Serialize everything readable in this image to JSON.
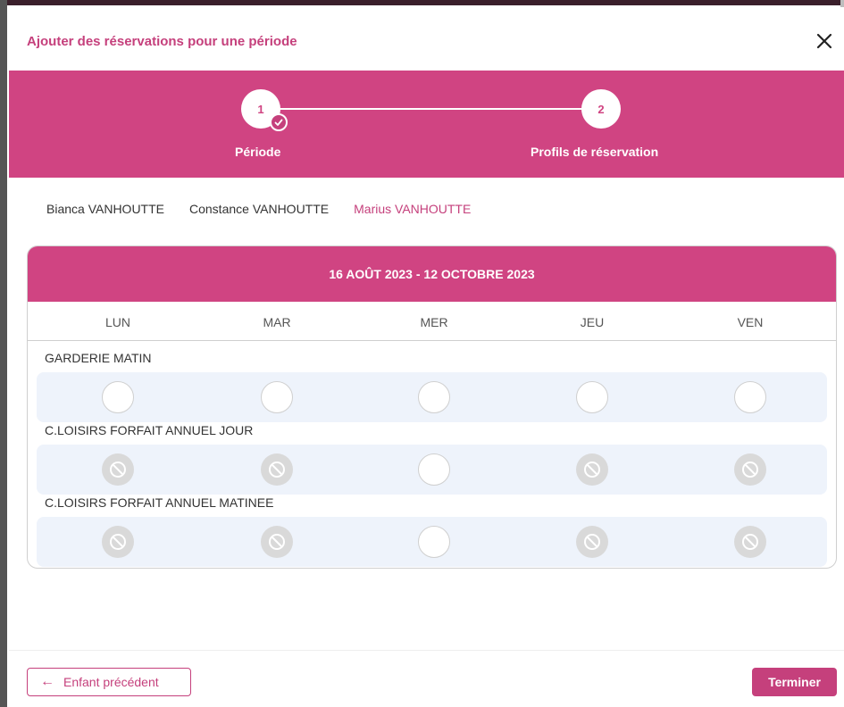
{
  "dialog": {
    "title": "Ajouter des réservations pour une période",
    "close_icon": "close-icon"
  },
  "stepper": {
    "steps": [
      {
        "number": "1",
        "label": "Période",
        "completed": true
      },
      {
        "number": "2",
        "label": "Profils de réservation",
        "completed": false
      }
    ],
    "accent_color": "#d04482"
  },
  "children": {
    "items": [
      "Bianca VANHOUTTE",
      "Constance VANHOUTTE",
      "Marius VANHOUTTE"
    ],
    "active": "Marius VANHOUTTE"
  },
  "calendar": {
    "period": "16 AOÛT 2023 - 12 OCTOBRE 2023",
    "days": [
      "LUN",
      "MAR",
      "MER",
      "JEU",
      "VEN"
    ],
    "activities": [
      {
        "name": "GARDERIE MATIN",
        "slots": [
          "free",
          "free",
          "free",
          "free",
          "free"
        ]
      },
      {
        "name": "C.LOISIRS FORFAIT ANNUEL JOUR",
        "slots": [
          "blocked",
          "blocked",
          "free",
          "blocked",
          "blocked"
        ]
      },
      {
        "name": "C.LOISIRS FORFAIT ANNUEL MATINEE",
        "slots": [
          "blocked",
          "blocked",
          "free",
          "blocked",
          "blocked"
        ]
      }
    ],
    "blocked_icon": "ban-icon"
  },
  "footer": {
    "previous_label": "Enfant précédent",
    "previous_icon": "arrow-left-icon",
    "finish_label": "Terminer"
  }
}
